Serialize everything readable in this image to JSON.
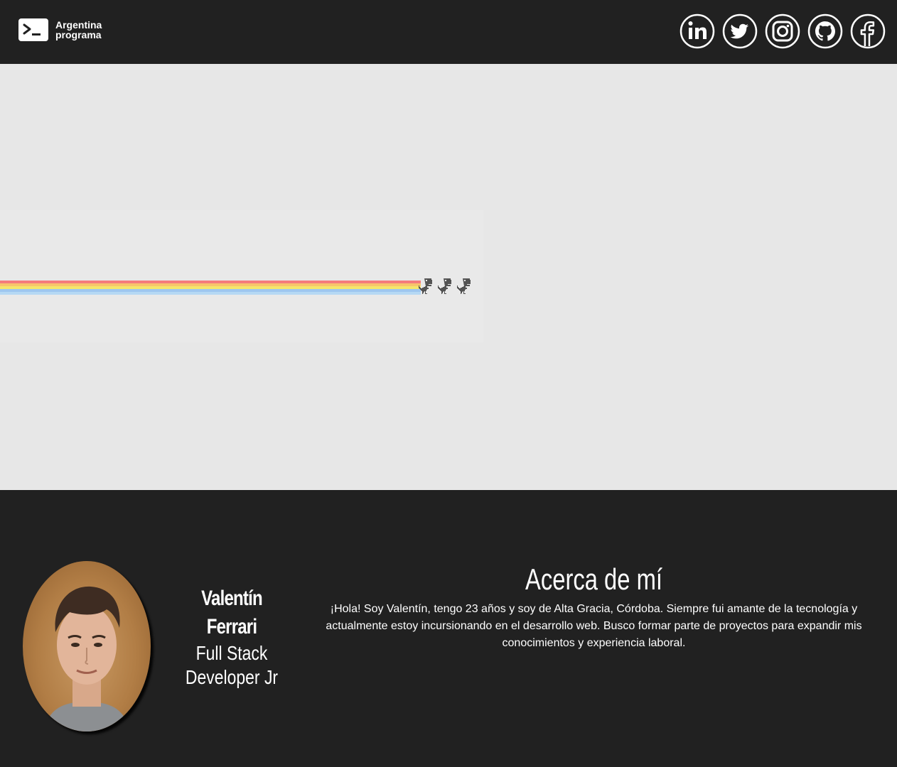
{
  "header": {
    "brand_line1": "Argentina",
    "brand_line2": "programa",
    "socials": [
      {
        "name": "linkedin-icon"
      },
      {
        "name": "twitter-icon"
      },
      {
        "name": "instagram-icon"
      },
      {
        "name": "github-icon"
      },
      {
        "name": "facebook-icon"
      }
    ]
  },
  "hero": {
    "rainbow_colors": [
      "#f47c7c",
      "#f7c56b",
      "#f5e66b",
      "#9ec7ef",
      "#b6d9f4"
    ],
    "dino_color": "#535353"
  },
  "profile": {
    "name": "Valentín Ferrari",
    "role": "Full Stack Developer Jr"
  },
  "about": {
    "title": "Acerca de mí",
    "description": "¡Hola! Soy Valentín, tengo 23 años y soy de Alta Gracia, Córdoba. Siempre fui amante de la tecnología y actualmente estoy incursionando en el desarrollo web. Busco formar parte de proyectos para expandir mis conocimientos y experiencia laboral."
  }
}
